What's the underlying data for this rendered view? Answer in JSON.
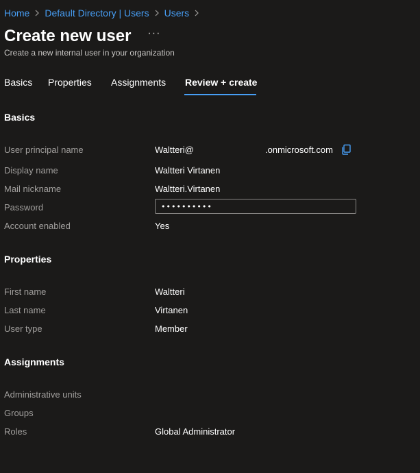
{
  "breadcrumb": {
    "items": [
      "Home",
      "Default Directory | Users",
      "Users"
    ]
  },
  "header": {
    "title": "Create new user",
    "more_label": "···",
    "subtitle": "Create a new internal user in your organization"
  },
  "tabs": [
    {
      "label": "Basics",
      "active": false
    },
    {
      "label": "Properties",
      "active": false
    },
    {
      "label": "Assignments",
      "active": false
    },
    {
      "label": "Review + create",
      "active": true
    }
  ],
  "basics": {
    "title": "Basics",
    "upn_label": "User principal name",
    "upn_prefix": "Waltteri@",
    "upn_domain": ".onmicrosoft.com",
    "display_name_label": "Display name",
    "display_name": "Waltteri Virtanen",
    "mail_nickname_label": "Mail nickname",
    "mail_nickname": "Waltteri.Virtanen",
    "password_label": "Password",
    "password_masked": "••••••••••",
    "account_enabled_label": "Account enabled",
    "account_enabled": "Yes"
  },
  "properties": {
    "title": "Properties",
    "first_name_label": "First name",
    "first_name": "Waltteri",
    "last_name_label": "Last name",
    "last_name": "Virtanen",
    "user_type_label": "User type",
    "user_type": "Member"
  },
  "assignments": {
    "title": "Assignments",
    "admin_units_label": "Administrative units",
    "groups_label": "Groups",
    "roles_label": "Roles",
    "roles": "Global Administrator"
  },
  "colors": {
    "background": "#1b1a19",
    "link": "#479ef5",
    "label": "#a19f9d",
    "text": "#ffffff"
  },
  "icons": {
    "breadcrumb_separator": "chevron-right-icon",
    "copy": "copy-icon"
  }
}
